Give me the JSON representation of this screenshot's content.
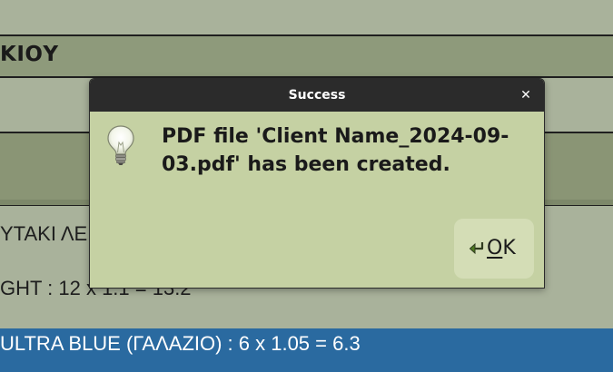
{
  "background_app": {
    "header_title": "ΚΙΟΥ",
    "lines": [
      "ΥΤΑΚΙ ΛΕΝ",
      "GHT :  12 x 1.1  = 13.2"
    ],
    "selected_row": "ULTRA BLUE (ΓΑΛΑΖΙΟ) :  6 x 1.05  = 6.3"
  },
  "dialog": {
    "title": "Success",
    "close_glyph": "✕",
    "icon": "lightbulb-icon",
    "message": "PDF file 'Client Name_2024-09-03.pdf' has been created.",
    "ok_button": {
      "mnemonic": "O",
      "rest": "K",
      "icon": "apply-arrow-icon"
    }
  },
  "colors": {
    "background": "#a9b29b",
    "header_band": "#8e9a7b",
    "dialog_body": "#c5d1a3",
    "titlebar": "#2b2b2b",
    "selection": "#2a6aa0",
    "ok_button": "#d4ddb6"
  }
}
